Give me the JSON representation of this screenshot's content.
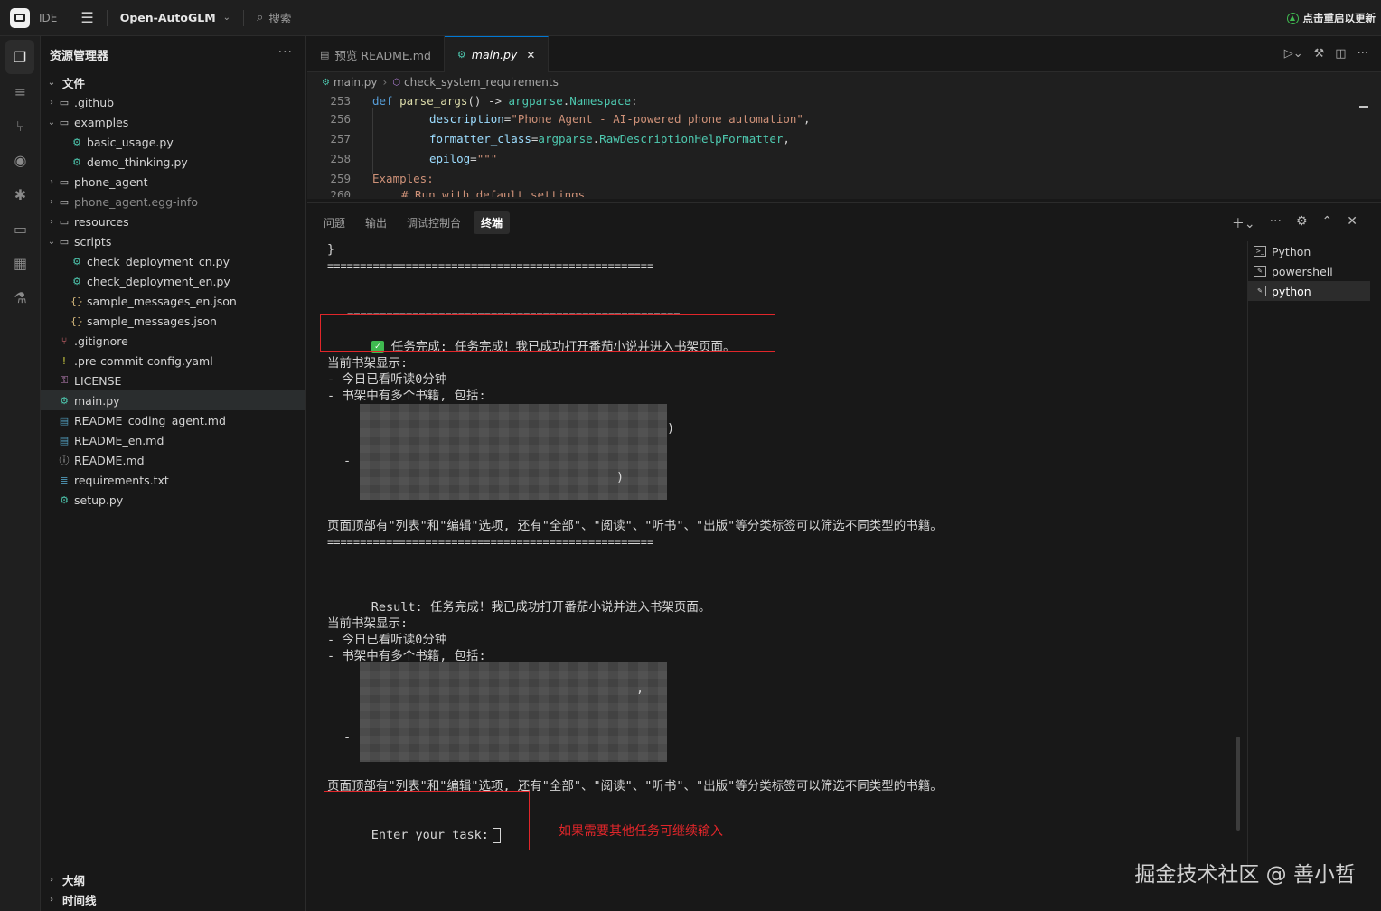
{
  "titlebar": {
    "ide_label": "IDE",
    "project": "Open-AutoGLM",
    "search_label": "搜索",
    "update_label": "点击重启以更新"
  },
  "sidebar": {
    "title": "资源管理器",
    "root": "文件",
    "items": [
      {
        "label": ".github",
        "kind": "folder",
        "level": 1,
        "expanded": false
      },
      {
        "label": "examples",
        "kind": "folder",
        "level": 1,
        "expanded": true
      },
      {
        "label": "basic_usage.py",
        "kind": "py",
        "level": 2
      },
      {
        "label": "demo_thinking.py",
        "kind": "py",
        "level": 2
      },
      {
        "label": "phone_agent",
        "kind": "folder",
        "level": 1,
        "expanded": false
      },
      {
        "label": "phone_agent.egg-info",
        "kind": "folder",
        "level": 1,
        "expanded": false,
        "dim": true
      },
      {
        "label": "resources",
        "kind": "folder",
        "level": 1,
        "expanded": false
      },
      {
        "label": "scripts",
        "kind": "folder",
        "level": 1,
        "expanded": true
      },
      {
        "label": "check_deployment_cn.py",
        "kind": "py",
        "level": 2
      },
      {
        "label": "check_deployment_en.py",
        "kind": "py",
        "level": 2
      },
      {
        "label": "sample_messages_en.json",
        "kind": "json",
        "level": 2
      },
      {
        "label": "sample_messages.json",
        "kind": "json",
        "level": 2
      },
      {
        "label": ".gitignore",
        "kind": "git",
        "level": 1
      },
      {
        "label": ".pre-commit-config.yaml",
        "kind": "yaml",
        "level": 1
      },
      {
        "label": "LICENSE",
        "kind": "license",
        "level": 1
      },
      {
        "label": "main.py",
        "kind": "py",
        "level": 1,
        "selected": true
      },
      {
        "label": "README_coding_agent.md",
        "kind": "md",
        "level": 1
      },
      {
        "label": "README_en.md",
        "kind": "md",
        "level": 1
      },
      {
        "label": "README.md",
        "kind": "info",
        "level": 1
      },
      {
        "label": "requirements.txt",
        "kind": "txt",
        "level": 1
      },
      {
        "label": "setup.py",
        "kind": "py",
        "level": 1
      }
    ],
    "outline": "大纲",
    "timeline": "时间线"
  },
  "editor": {
    "tabs": [
      {
        "label": "预览 README.md",
        "active": false
      },
      {
        "label": "main.py",
        "active": true
      }
    ],
    "breadcrumb": [
      "main.py",
      "check_system_requirements"
    ],
    "lines": [
      {
        "num": "253"
      },
      {
        "num": "256"
      },
      {
        "num": "257"
      },
      {
        "num": "258"
      },
      {
        "num": "259"
      },
      {
        "num": "260"
      }
    ],
    "code": {
      "l253_def": "def ",
      "l253_fn": "parse_args",
      "l253_rest": "() -> ",
      "l253_mod": "argparse",
      "l253_dot": ".",
      "l253_cls": "Namespace",
      "l253_colon": ":",
      "l256_param": "description",
      "l256_eq": "=",
      "l256_str": "\"Phone Agent - AI-powered phone automation\"",
      "l256_comma": ",",
      "l257_param": "formatter_class",
      "l257_eq": "=",
      "l257_mod": "argparse",
      "l257_dot": ".",
      "l257_cls": "RawDescriptionHelpFormatter",
      "l257_comma": ",",
      "l258_param": "epilog",
      "l258_eq": "=",
      "l258_str": "\"\"\"",
      "l259_text": "Examples:",
      "l260_text": "# Run with default settings"
    }
  },
  "panel": {
    "tabs": [
      {
        "label": "问题",
        "active": false
      },
      {
        "label": "输出",
        "active": false
      },
      {
        "label": "调试控制台",
        "active": false
      },
      {
        "label": "终端",
        "active": true
      }
    ],
    "terminal_list": [
      {
        "label": "Python",
        "active": false
      },
      {
        "label": "powershell",
        "active": false
      },
      {
        "label": "python",
        "active": true
      }
    ],
    "terminal": {
      "brace": "}",
      "rule": "==================================================",
      "rule2": "===================================================",
      "task_done": "任务完成: 任务完成！我已成功打开番茄小说并进入书架页面。",
      "shelf_title": "当前书架显示:",
      "shelf_line1": "- 今日已看听读0分钟",
      "shelf_line2": "- 书架中有多个书籍, 包括:",
      "paren1": ")",
      "dash": "-",
      "paren2": ")",
      "top_tabs": "页面顶部有\"列表\"和\"编辑\"选项, 还有\"全部\"、\"阅读\"、\"听书\"、\"出版\"等分类标签可以筛选不同类型的书籍。",
      "result_label": "Result:",
      "result_text": " 任务完成！我已成功打开番茄小说并进入书架页面。",
      "comma": ",",
      "prompt": "Enter your task:"
    },
    "annotation": "如果需要其他任务可继续输入",
    "watermark": "掘金技术社区 @ 善小哲"
  },
  "colors": {
    "highlight_box": "#e0262a",
    "accent": "#0078d4",
    "success": "#3fb950"
  }
}
